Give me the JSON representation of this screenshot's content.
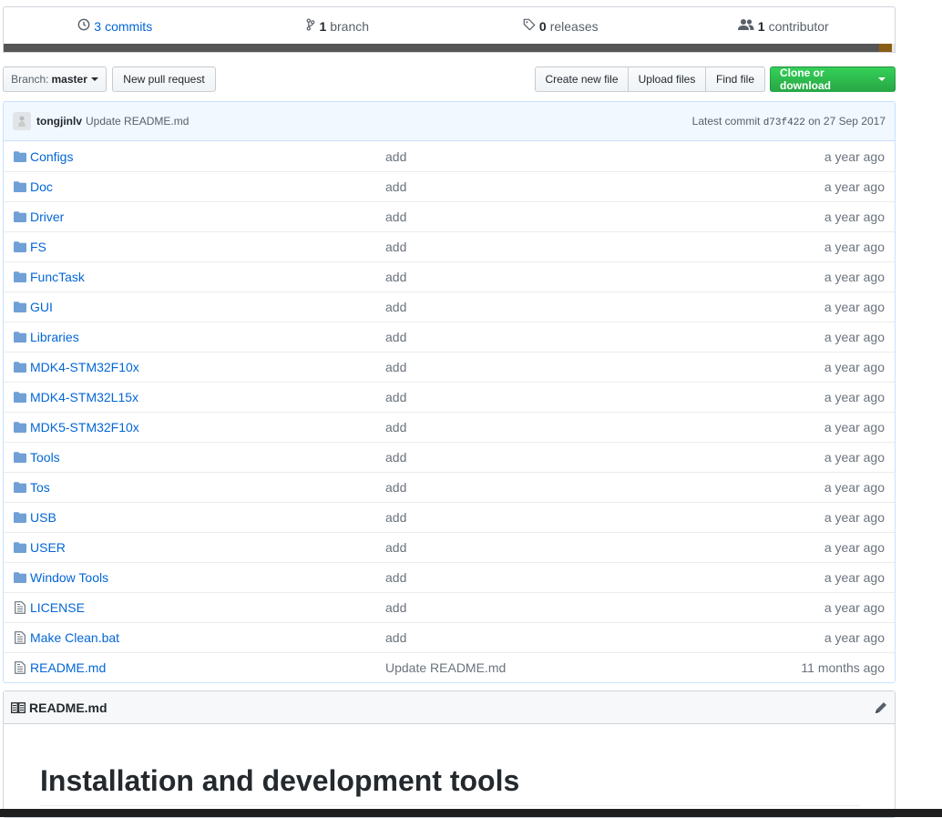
{
  "summary": {
    "commits_num": "3",
    "commits_label": "commits",
    "branch_num": "1",
    "branch_label": "branch",
    "releases_num": "0",
    "releases_label": "releases",
    "contributor_num": "1",
    "contributor_label": "contributor"
  },
  "toolbar": {
    "branch_prefix": "Branch:",
    "branch_name": "master",
    "new_pr": "New pull request",
    "create_file": "Create new file",
    "upload_files": "Upload files",
    "find_file": "Find file",
    "clone": "Clone or download"
  },
  "commit": {
    "author": "tongjinlv",
    "message": "Update README.md",
    "latest_prefix": "Latest commit",
    "sha": "d73f422",
    "date": "on 27 Sep 2017"
  },
  "files": [
    {
      "name": "Configs",
      "type": "folder",
      "message": "add",
      "age": "a year ago"
    },
    {
      "name": "Doc",
      "type": "folder",
      "message": "add",
      "age": "a year ago"
    },
    {
      "name": "Driver",
      "type": "folder",
      "message": "add",
      "age": "a year ago"
    },
    {
      "name": "FS",
      "type": "folder",
      "message": "add",
      "age": "a year ago"
    },
    {
      "name": "FuncTask",
      "type": "folder",
      "message": "add",
      "age": "a year ago"
    },
    {
      "name": "GUI",
      "type": "folder",
      "message": "add",
      "age": "a year ago"
    },
    {
      "name": "Libraries",
      "type": "folder",
      "message": "add",
      "age": "a year ago"
    },
    {
      "name": "MDK4-STM32F10x",
      "type": "folder",
      "message": "add",
      "age": "a year ago"
    },
    {
      "name": "MDK4-STM32L15x",
      "type": "folder",
      "message": "add",
      "age": "a year ago"
    },
    {
      "name": "MDK5-STM32F10x",
      "type": "folder",
      "message": "add",
      "age": "a year ago"
    },
    {
      "name": "Tools",
      "type": "folder",
      "message": "add",
      "age": "a year ago"
    },
    {
      "name": "Tos",
      "type": "folder",
      "message": "add",
      "age": "a year ago"
    },
    {
      "name": "USB",
      "type": "folder",
      "message": "add",
      "age": "a year ago"
    },
    {
      "name": "USER",
      "type": "folder",
      "message": "add",
      "age": "a year ago"
    },
    {
      "name": "Window Tools",
      "type": "folder",
      "message": "add",
      "age": "a year ago"
    },
    {
      "name": "LICENSE",
      "type": "file",
      "message": "add",
      "age": "a year ago"
    },
    {
      "name": "Make Clean.bat",
      "type": "file",
      "message": "add",
      "age": "a year ago"
    },
    {
      "name": "README.md",
      "type": "file",
      "message": "Update README.md",
      "age": "11 months ago"
    }
  ],
  "readme": {
    "title": "README.md",
    "heading": "Installation and development tools"
  },
  "colors": {
    "link": "#0366d6",
    "clone_green": "#28a745",
    "lang_primary": "#555555",
    "lang_secondary": "#8a5d16"
  }
}
